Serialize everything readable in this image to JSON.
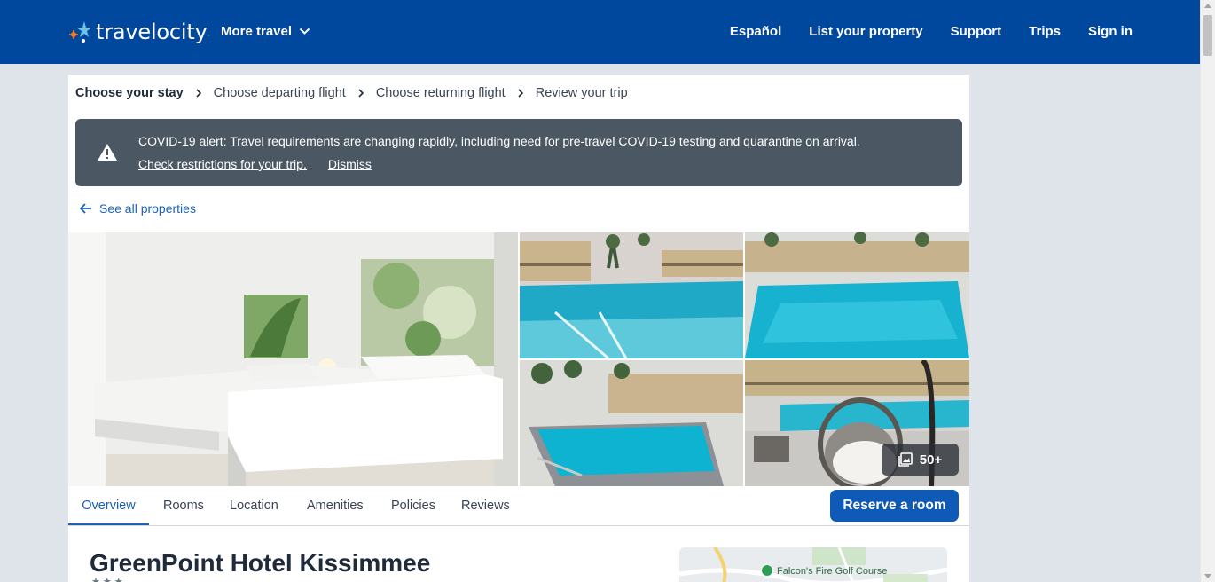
{
  "header": {
    "logo_text": "travelocity",
    "logo_mark": "·",
    "more_travel": "More travel",
    "nav": [
      "Español",
      "List your property",
      "Support",
      "Trips",
      "Sign in"
    ]
  },
  "steps": [
    "Choose your stay",
    "Choose departing flight",
    "Choose returning flight",
    "Review your trip"
  ],
  "alert": {
    "text": "COVID-19 alert: Travel requirements are changing rapidly, including need for pre-travel COVID-19 testing and quarantine on arrival.",
    "link_check": "Check restrictions for your trip.",
    "link_dismiss": "Dismiss"
  },
  "back_link": "See all properties",
  "gallery": {
    "count_label": "50+"
  },
  "tabs": [
    "Overview",
    "Rooms",
    "Location",
    "Amenities",
    "Policies",
    "Reviews"
  ],
  "reserve_label": "Reserve a room",
  "hotel": {
    "name": "GreenPoint Hotel Kissimmee",
    "stars": "★★★"
  },
  "map": {
    "label": "Falcon's Fire Golf Course"
  },
  "colors": {
    "header": "#00479e",
    "accent": "#1b61b8",
    "alert_bg": "#4b5863",
    "button": "#0f59b7"
  }
}
